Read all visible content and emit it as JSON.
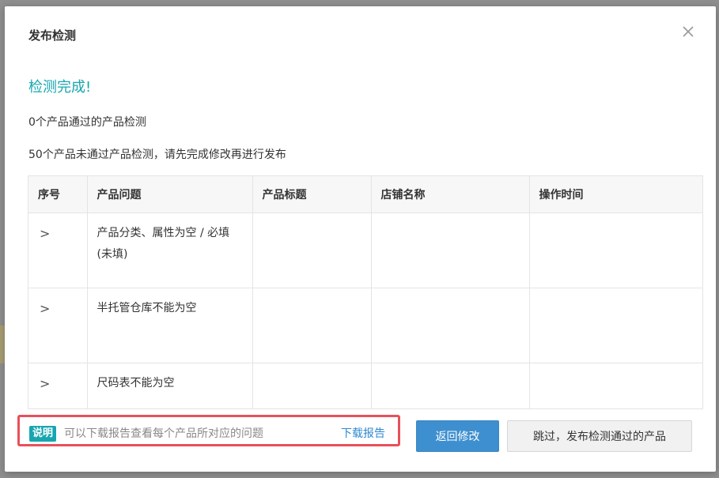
{
  "modal": {
    "title": "发布检测",
    "close_icon": "close-icon"
  },
  "result": {
    "title": "检测完成!",
    "passed_text": "0个产品通过的产品检测",
    "failed_text": "50个产品未通过产品检测，请先完成修改再进行发布"
  },
  "table": {
    "columns": [
      "序号",
      "产品问题",
      "产品标题",
      "店铺名称",
      "操作时间"
    ],
    "rows": [
      {
        "expand_icon": ">",
        "issue": "产品分类、属性为空 / 必填(未填)",
        "title": "",
        "shop": "",
        "time": ""
      },
      {
        "expand_icon": ">",
        "issue": "半托管仓库不能为空",
        "title": "",
        "shop": "",
        "time": ""
      },
      {
        "expand_icon": ">",
        "issue": "尺码表不能为空",
        "title": "",
        "shop": "",
        "time": ""
      }
    ]
  },
  "note": {
    "badge": "说明",
    "text": "可以下载报告查看每个产品所对应的问题",
    "link": "下载报告"
  },
  "buttons": {
    "back": "返回修改",
    "skip": "跳过，发布检测通过的产品"
  },
  "colors": {
    "accent": "#17a6b0",
    "primary": "#3e8fcf",
    "highlight": "#e8505a",
    "link": "#2f88d0"
  }
}
